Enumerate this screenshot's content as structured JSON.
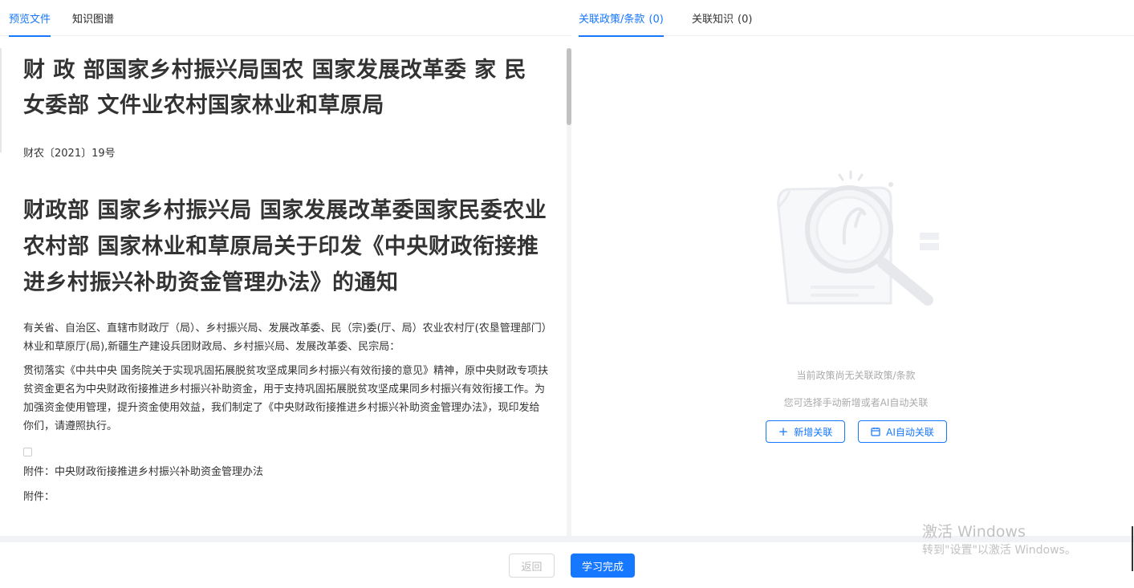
{
  "left_tabs": [
    {
      "label": "预览文件",
      "active": true
    },
    {
      "label": "知识图谱",
      "active": false
    }
  ],
  "right_tabs": [
    {
      "label": "关联政策/条款",
      "count": "(0)",
      "active": true
    },
    {
      "label": "关联知识",
      "count": "(0)",
      "active": false
    }
  ],
  "document": {
    "title": "财 政 部国家乡村振兴局国农 国家发展改革委 家 民 女委部 文件业农村国家林业和草原局",
    "number": "财农〔2021〕19号",
    "heading": "财政部 国家乡村振兴局 国家发展改革委国家民委农业农村部 国家林业和草原局关于印发《中央财政衔接推进乡村振兴补助资金管理办法》的通知",
    "addressees": "有关省、自治区、直辖市财政厅（局）、乡村振兴局、发展改革委、民（宗)委(厅、局）农业农村厅(农垦管理部门）林业和草原厅(局),新疆生产建设兵团财政局、乡村振兴局、发展改革委、民宗局：",
    "body": "贯彻落实《中共中央 国务院关于实现巩固拓展脱贫攻坚成果同乡村振兴有效衔接的意见》精神，原中央财政专项扶贫资金更名为中央财政衔接推进乡村振兴补助资金，用于支持巩固拓展脱贫攻坚成果同乡村振兴有效衔接工作。为加强资金使用管理，提升资金使用效益，我们制定了《中央财政衔接推进乡村振兴补助资金管理办法》，现印发给你们，请遵照执行。",
    "attachment1": "附件：中央财政衔接推进乡村振兴补助资金管理办法",
    "attachment2": "附件："
  },
  "empty_state": {
    "title": "当前政策尚无关联政策/条款",
    "subtitle": "您可选择手动新增或者AI自动关联",
    "add_button": "新增关联",
    "ai_button": "AI自动关联"
  },
  "footer": {
    "back_button": "返回",
    "done_button": "学习完成"
  },
  "watermark": {
    "line1": "激活 Windows",
    "line2": "转到\"设置\"以激活 Windows。"
  },
  "colors": {
    "accent": "#1677ff",
    "muted_text": "#aaaaaa"
  }
}
